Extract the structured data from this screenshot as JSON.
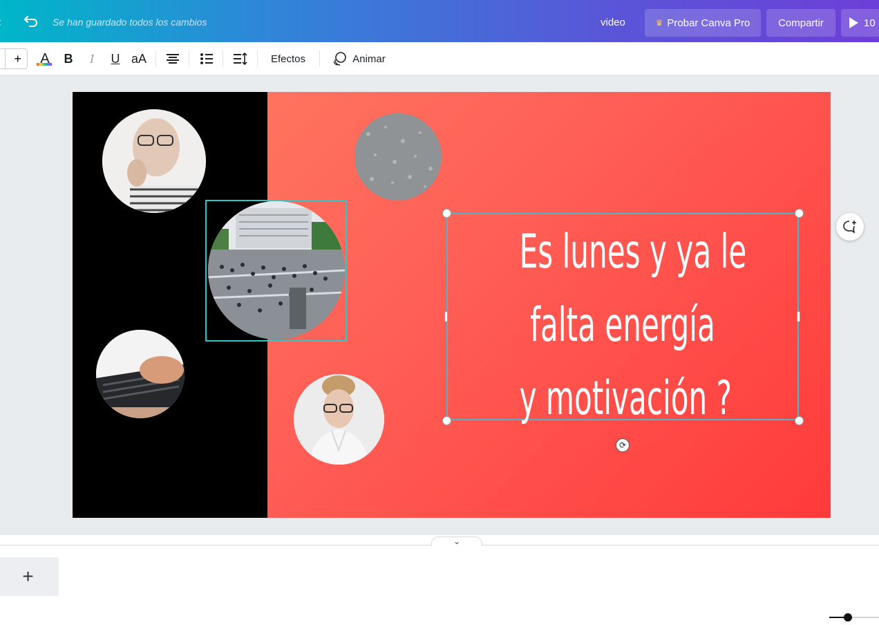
{
  "topbar": {
    "saved_status": "Se han guardado todos los cambios",
    "video_label": "video",
    "pro_button": "Probar Canva Pro",
    "share_button": "Compartir",
    "play_button": "10"
  },
  "toolbar": {
    "font_size_plus": "+",
    "text_color_label": "A",
    "bold_label": "B",
    "italic_label": "I",
    "underline_label": "U",
    "case_label": "aA",
    "effects_label": "Efectos",
    "animate_label": "Animar"
  },
  "canvas": {
    "headline_lines": [
      "Es lunes y ya le",
      "falta energía",
      "y motivación ?"
    ],
    "background_colors": [
      "#ff7e63",
      "#ff3a3a"
    ],
    "left_panel_color": "#000000",
    "selection_color": "#2fc6c6"
  },
  "footer": {
    "add_page_label": "+",
    "collapse_icon": "chevron-down-icon"
  }
}
